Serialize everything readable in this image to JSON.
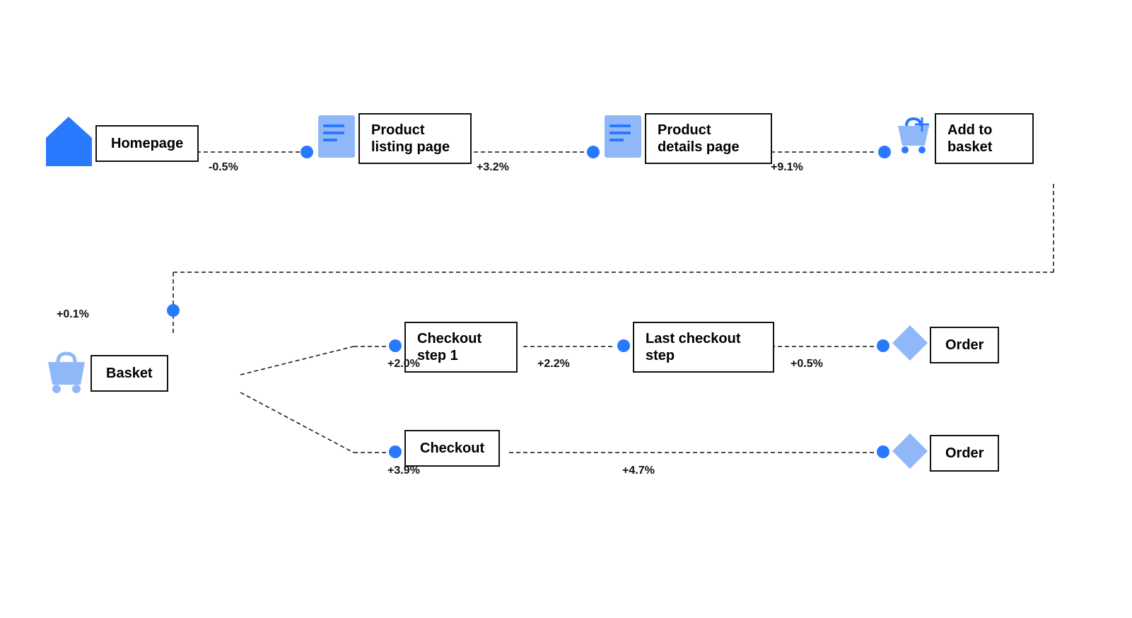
{
  "nodes": {
    "homepage": {
      "label": "Homepage"
    },
    "product_listing": {
      "label": "Product\nlisting page"
    },
    "product_details": {
      "label": "Product\ndetails page"
    },
    "add_to_basket": {
      "label": "Add to\nbasket"
    },
    "basket": {
      "label": "Basket"
    },
    "checkout_step1": {
      "label": "Checkout\nstep 1"
    },
    "last_checkout": {
      "label": "Last checkout\nstep"
    },
    "order1": {
      "label": "Order"
    },
    "checkout": {
      "label": "Checkout"
    },
    "order2": {
      "label": "Order"
    }
  },
  "edges": {
    "home_to_listing": {
      "label": "-0.5%"
    },
    "listing_to_details": {
      "label": "+3.2%"
    },
    "details_to_basket_add": {
      "label": "+9.1%"
    },
    "add_to_basket_down": {
      "label": "+0.1%"
    },
    "basket_to_checkout1": {
      "label": "+2.0%"
    },
    "checkout1_to_last": {
      "label": "+2.2%"
    },
    "last_to_order1": {
      "label": "+0.5%"
    },
    "basket_to_checkout": {
      "label": "+3.9%"
    },
    "checkout_to_order2": {
      "label": "+4.7%"
    }
  },
  "colors": {
    "blue": "#2979ff",
    "light_blue": "#90b8f8",
    "dark": "#111111",
    "white": "#ffffff"
  }
}
